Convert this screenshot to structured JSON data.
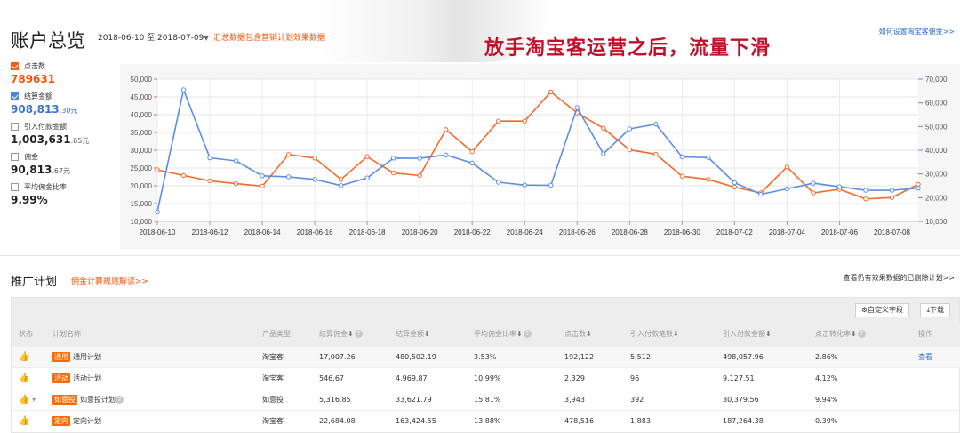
{
  "header": {
    "title": "账户总览",
    "date_range": "2018-06-10 至 2018-07-09",
    "summary_note": "汇总数据包含营销计划效果数据",
    "headline": "放手淘宝客运营之后，流量下滑",
    "help_link": "如何设置淘宝客佣金>>"
  },
  "metrics": [
    {
      "label": "点击数",
      "checked": true,
      "color": "#ff5a1a",
      "value_main": "789631",
      "value_small": ""
    },
    {
      "label": "结算金额",
      "checked": true,
      "color": "#4b84e4",
      "value_main": "908,813",
      "value_small": ".30元"
    },
    {
      "label": "引入付款金额",
      "checked": false,
      "value_main": "1,003,631",
      "value_small": ".65元"
    },
    {
      "label": "佣金",
      "checked": false,
      "value_main": "90,813",
      "value_small": ".67元"
    },
    {
      "label": "平均佣金比率",
      "checked": false,
      "value_main": "9.99%",
      "value_small": ""
    }
  ],
  "chart_data": {
    "type": "line",
    "x": [
      "2018-06-10",
      "2018-06-11",
      "2018-06-12",
      "2018-06-13",
      "2018-06-14",
      "2018-06-15",
      "2018-06-16",
      "2018-06-17",
      "2018-06-18",
      "2018-06-19",
      "2018-06-20",
      "2018-06-21",
      "2018-06-22",
      "2018-06-23",
      "2018-06-24",
      "2018-06-25",
      "2018-06-26",
      "2018-06-27",
      "2018-06-28",
      "2018-06-29",
      "2018-06-30",
      "2018-07-01",
      "2018-07-02",
      "2018-07-03",
      "2018-07-04",
      "2018-07-05",
      "2018-07-06",
      "2018-07-07",
      "2018-07-08",
      "2018-07-09"
    ],
    "x_tick_labels": [
      "2018-06-10",
      "2018-06-12",
      "2018-06-14",
      "2018-06-16",
      "2018-06-18",
      "2018-06-20",
      "2018-06-22",
      "2018-06-24",
      "2018-06-26",
      "2018-06-28",
      "2018-06-30",
      "2018-07-02",
      "2018-07-04",
      "2018-07-06",
      "2018-07-08"
    ],
    "y_left_ticks": [
      "10,000",
      "15,000",
      "20,000",
      "25,000",
      "30,000",
      "35,000",
      "40,000",
      "45,000",
      "50,000"
    ],
    "y_right_ticks": [
      "10,000",
      "20,000",
      "30,000",
      "40,000",
      "50,000",
      "60,000",
      "70,000"
    ],
    "ylim_left": [
      10000,
      50000
    ],
    "ylim_right": [
      10000,
      70000
    ],
    "grid": true,
    "series": [
      {
        "color": "#f26b2b",
        "axis": "left",
        "values": [
          24500,
          22900,
          21400,
          20600,
          19900,
          28800,
          27800,
          21800,
          28200,
          23600,
          22900,
          35800,
          29600,
          38200,
          38200,
          46400,
          40500,
          36200,
          30100,
          28900,
          22700,
          21800,
          19600,
          18000,
          25300,
          18000,
          19000,
          16300,
          16700,
          20400
        ]
      },
      {
        "color": "#5b8ee6",
        "axis": "right",
        "values": [
          14000,
          65500,
          36800,
          35500,
          29200,
          28800,
          27700,
          25100,
          28300,
          36700,
          36600,
          38000,
          34600,
          26500,
          25300,
          25200,
          58000,
          38500,
          49000,
          51000,
          37200,
          36900,
          26300,
          21400,
          23700,
          26100,
          24600,
          23100,
          23100,
          24000
        ]
      }
    ]
  },
  "plans": {
    "title": "推广计划",
    "rules_link": "佣金计算规则解读>>",
    "deleted_link": "查看仍有效果数据的已删除计划>>",
    "toolbar": {
      "custom_fields": "自定义字段",
      "download": "下载"
    },
    "columns": [
      "状态",
      "计划名称",
      "产品类型",
      "结算佣金",
      "结算金额",
      "平均佣金比率",
      "点击数",
      "引入付款笔数",
      "引入付款金额",
      "点击转化率",
      "操作"
    ],
    "rows": [
      {
        "tag": "通用",
        "name": "通用计划",
        "type": "淘宝客",
        "commission": "17,007.26",
        "amount": "480,502.19",
        "rate": "3.53%",
        "clicks": "192,122",
        "orders": "5,512",
        "pay_amount": "498,057.96",
        "cvr": "2.86%",
        "op": "查看"
      },
      {
        "tag": "活动",
        "name": "活动计划",
        "type": "淘宝客",
        "commission": "546.67",
        "amount": "4,969.87",
        "rate": "10.99%",
        "clicks": "2,329",
        "orders": "96",
        "pay_amount": "9,127.51",
        "cvr": "4.12%",
        "op": ""
      },
      {
        "tag": "如意投",
        "name": "如意投计划",
        "type": "如意投",
        "commission": "5,316.85",
        "amount": "33,621.79",
        "rate": "15.81%",
        "clicks": "3,943",
        "orders": "392",
        "pay_amount": "30,379.56",
        "cvr": "9.94%",
        "op": ""
      },
      {
        "tag": "定向",
        "name": "定向计划",
        "type": "淘宝客",
        "commission": "22,684.08",
        "amount": "163,424.55",
        "rate": "13.88%",
        "clicks": "478,516",
        "orders": "1,883",
        "pay_amount": "187,264.38",
        "cvr": "0.39%",
        "op": ""
      }
    ]
  }
}
